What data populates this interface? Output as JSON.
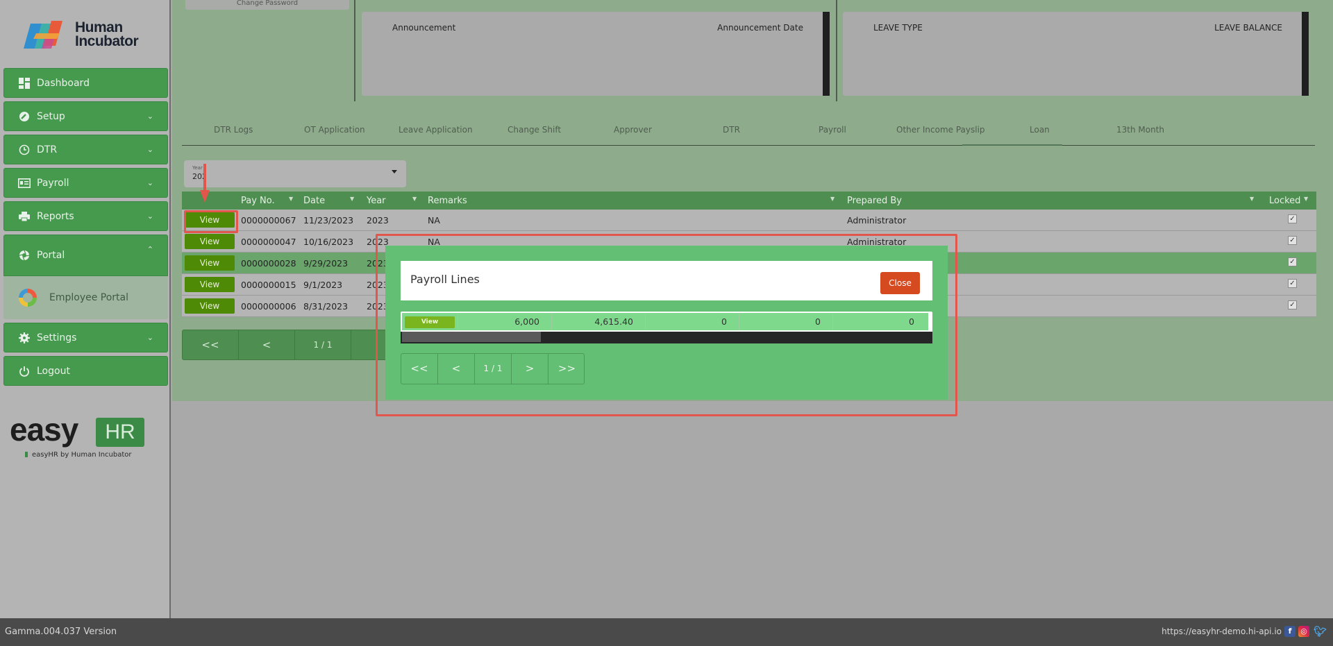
{
  "brand": {
    "logo_text_line1": "Human",
    "logo_text_line2": "Incubator",
    "easy": "easy",
    "hr": "HR",
    "tagline": "easyHR by Human Incubator"
  },
  "sidebar": {
    "items": [
      {
        "label": "Dashboard",
        "icon": "dashboard-icon"
      },
      {
        "label": "Setup",
        "icon": "wrench-icon"
      },
      {
        "label": "DTR",
        "icon": "clock-icon"
      },
      {
        "label": "Payroll",
        "icon": "payroll-icon"
      },
      {
        "label": "Reports",
        "icon": "printer-icon"
      },
      {
        "label": "Portal",
        "icon": "aperture-icon"
      },
      {
        "label": "Settings",
        "icon": "gear-icon"
      },
      {
        "label": "Logout",
        "icon": "power-icon"
      }
    ],
    "portal_sub": {
      "label": "Employee Portal",
      "icon": "employee-portal-icon"
    }
  },
  "top": {
    "change_password": "Change Password",
    "announcement_header": "Announcement",
    "announcement_date_header": "Announcement Date",
    "leave_type_header": "LEAVE TYPE",
    "leave_balance_header": "LEAVE BALANCE"
  },
  "tabs": [
    "DTR Logs",
    "OT Application",
    "Leave Application",
    "Change Shift",
    "Approver",
    "DTR",
    "Payroll",
    "Other Income Payslip",
    "Loan",
    "13th Month"
  ],
  "year_select": {
    "label": "Year",
    "value": "202"
  },
  "table": {
    "headers": [
      "Pay No.",
      "Date",
      "Year",
      "Remarks",
      "Prepared By",
      "Locked"
    ],
    "view_label": "View",
    "rows": [
      {
        "pay_no": "0000000067",
        "date": "11/23/2023",
        "year": "2023",
        "remarks": "NA",
        "prepared_by": "Administrator",
        "locked": "✓"
      },
      {
        "pay_no": "0000000047",
        "date": "10/16/2023",
        "year": "2023",
        "remarks": "NA",
        "prepared_by": "Administrator",
        "locked": "✓"
      },
      {
        "pay_no": "0000000028",
        "date": "9/29/2023",
        "year": "2023",
        "remarks": "",
        "prepared_by": "",
        "locked": "✓"
      },
      {
        "pay_no": "0000000015",
        "date": "9/1/2023",
        "year": "2023",
        "remarks": "",
        "prepared_by": "",
        "locked": "✓"
      },
      {
        "pay_no": "0000000006",
        "date": "8/31/2023",
        "year": "2023",
        "remarks": "",
        "prepared_by": "",
        "locked": "✓"
      }
    ],
    "pager": {
      "first": "<<",
      "prev": "<",
      "page": "1 / 1"
    }
  },
  "modal": {
    "title": "Payroll Lines",
    "close_label": "Close",
    "row": {
      "view": "View",
      "values": [
        "6,000",
        "4,615.40",
        "0",
        "0",
        "0"
      ]
    },
    "pager": {
      "first": "<<",
      "prev": "<",
      "page": "1 / 1",
      "next": ">",
      "last": ">>"
    }
  },
  "footer": {
    "version": "Gamma.004.037 Version",
    "url": "https://easyhr-demo.hi-api.io"
  },
  "colors": {
    "accent_green": "#469a4e",
    "close_red": "#d64a1f",
    "highlight_red": "#e2564c"
  }
}
